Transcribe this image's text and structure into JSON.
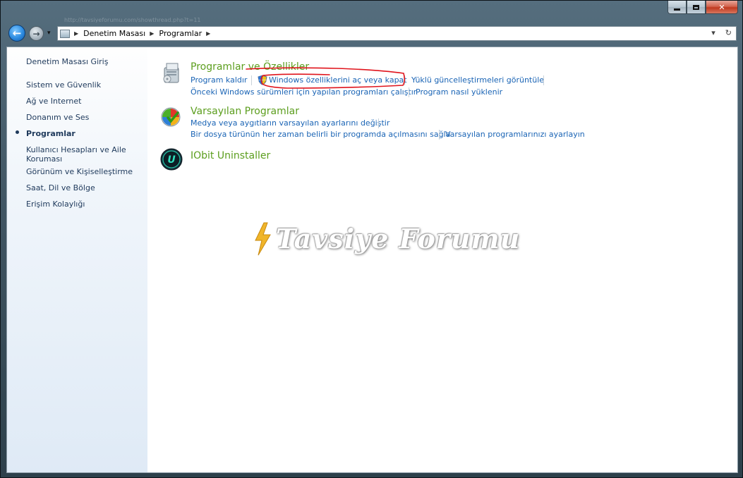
{
  "window": {
    "caption": {
      "minimize": "",
      "maximize": "",
      "close": "✕"
    },
    "url_ghost": "http://tavsiyeforumu.com/showthread.php?t=11"
  },
  "nav": {
    "back_icon": "arrow-left-icon",
    "forward_icon": "arrow-right-icon",
    "breadcrumb": [
      "Denetim Masası",
      "Programlar"
    ],
    "dropdown_glyph": "▾",
    "refresh_glyph": "↻"
  },
  "sidebar": {
    "items": [
      {
        "label": "Denetim Masası Giriş",
        "bold": false
      },
      {
        "label": "Sistem ve Güvenlik",
        "bold": false
      },
      {
        "label": "Ağ ve Internet",
        "bold": false
      },
      {
        "label": "Donanım ve Ses",
        "bold": false
      },
      {
        "label": "Programlar",
        "bold": true,
        "selected": true
      },
      {
        "label": "Kullanıcı Hesapları ve Aile Koruması",
        "bold": false
      },
      {
        "label": "Görünüm ve Kişiselleştirme",
        "bold": false
      },
      {
        "label": "Saat, Dil ve Bölge",
        "bold": false
      },
      {
        "label": "Erişim Kolaylığı",
        "bold": false
      }
    ]
  },
  "categories": [
    {
      "title": "Programlar ve Özellikler",
      "icon": "programs-features-icon",
      "links_row1": [
        "Program kaldır",
        "Windows özelliklerini aç veya kapat",
        "Yüklü güncelleştirmeleri görüntüle"
      ],
      "links_row2": [
        "Önceki Windows sürümleri için yapılan programları çalıştır",
        "Program nasıl yüklenir"
      ]
    },
    {
      "title": "Varsayılan Programlar",
      "icon": "default-programs-icon",
      "links_row1": [
        "Medya veya aygıtların varsayılan ayarlarını değiştir"
      ],
      "links_row2": [
        "Bir dosya türünün her zaman belirli bir programda açılmasını sağla",
        "Varsayılan programlarınızı ayarlayın"
      ]
    },
    {
      "title": "IObit Uninstaller",
      "icon": "iobit-uninstaller-icon",
      "icon_letter": "U"
    }
  ],
  "watermark": {
    "text": "Tavsiye Forumu"
  },
  "colors": {
    "category_title": "#5c9e1e",
    "link": "#1a64b5",
    "sidebar_text": "#1e395b",
    "annotation": "#e0141c"
  }
}
